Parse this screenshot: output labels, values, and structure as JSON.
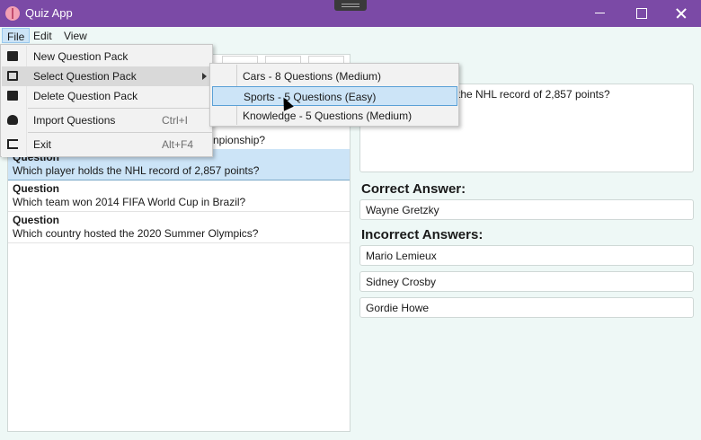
{
  "window": {
    "title": "Quiz App"
  },
  "menubar": {
    "items": [
      "File",
      "Edit",
      "View"
    ]
  },
  "file_menu": {
    "items": [
      {
        "label": "New Question Pack",
        "shortcut": "",
        "icon": "folder-add-icon"
      },
      {
        "label": "Select Question Pack",
        "shortcut": "",
        "icon": "folder-open-icon",
        "has_submenu": true
      },
      {
        "label": "Delete Question Pack",
        "shortcut": "",
        "icon": "folder-delete-icon"
      },
      {
        "label": "Import Questions",
        "shortcut": "Ctrl+I",
        "icon": "cloud-download-icon"
      },
      {
        "label": "Exit",
        "shortcut": "Alt+F4",
        "icon": "exit-icon"
      }
    ]
  },
  "submenu": {
    "items": [
      "Cars - 8 Questions (Medium)",
      "Sports - 5 Questions (Easy)",
      "Knowledge - 5 Questions (Medium)"
    ]
  },
  "question_list": {
    "partial_text": "npionship?",
    "items": [
      {
        "heading": "Question",
        "text": "Which player holds the NHL record of 2,857 points?",
        "selected": true
      },
      {
        "heading": "Question",
        "text": "Which team won 2014 FIFA World Cup in Brazil?",
        "selected": false
      },
      {
        "heading": "Question",
        "text": "Which country hosted the 2020 Summer Olympics?",
        "selected": false
      }
    ]
  },
  "editor": {
    "question_text": "the NHL record of 2,857 points?",
    "correct_label": "Correct Answer:",
    "correct_answer": "Wayne Gretzky",
    "incorrect_label": "Incorrect Answers:",
    "incorrect_answers": [
      "Mario Lemieux",
      "Sidney Crosby",
      "Gordie Howe"
    ]
  },
  "colors": {
    "titlebar": "#7b4aa6",
    "background": "#eef8f6",
    "selection": "#cce4f7"
  }
}
